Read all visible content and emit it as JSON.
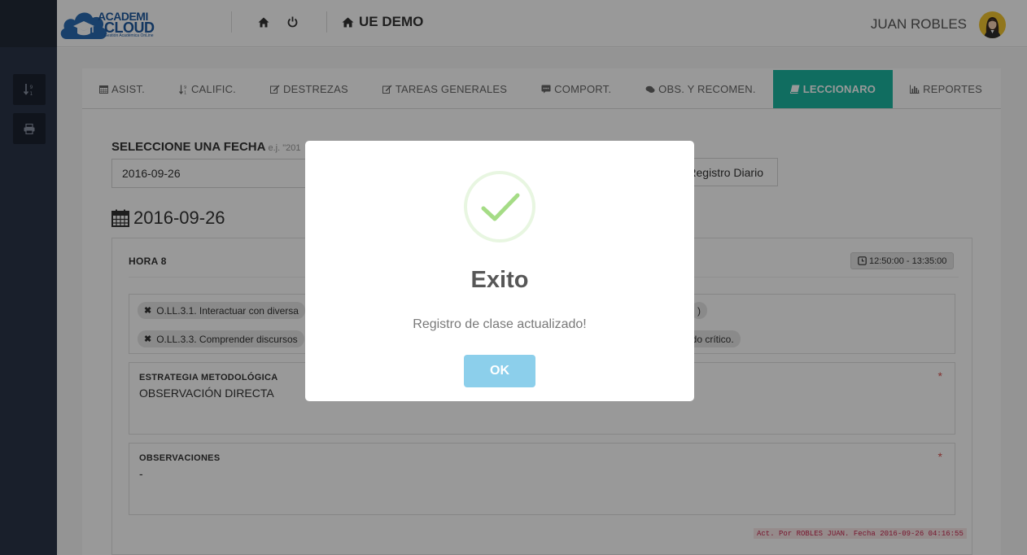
{
  "header": {
    "logo_line1": "ACADEMI",
    "logo_line2": "CLOUD",
    "logo_tagline": "Gestión Académica OnLine",
    "school": "UE DEMO",
    "user": "JUAN ROBLES"
  },
  "sidebar": {
    "items": [
      {
        "icon": "sort-numeric-icon"
      },
      {
        "icon": "print-icon"
      }
    ]
  },
  "tabs": [
    {
      "label": "ASIST.",
      "icon": "calendar-icon"
    },
    {
      "label": "CALIFIC.",
      "icon": "sort-numeric-icon"
    },
    {
      "label": "DESTREZAS",
      "icon": "edit-icon"
    },
    {
      "label": "TAREAS GENERALES",
      "icon": "edit-icon"
    },
    {
      "label": "COMPORT.",
      "icon": "comment-icon"
    },
    {
      "label": "OBS. Y RECOMEN.",
      "icon": "comments-icon"
    },
    {
      "label": "LECCIONARO",
      "icon": "book-icon",
      "active": true
    },
    {
      "label": "REPORTES",
      "icon": "bar-chart-icon"
    }
  ],
  "form": {
    "select_label": "SELECCIONE UNA FECHA",
    "example": "e.j. \"201",
    "date_value": "2016-09-26",
    "register_button": "Registro Diario"
  },
  "lesson": {
    "date_heading": "2016-09-26",
    "hour": "HORA 8",
    "time_range": "12:50:00 - 13:35:00",
    "tags": [
      {
        "label": "O.LL.3.1. Interactuar con diversa",
        "tail": ")"
      },
      {
        "label": "O.LL.3.3. Comprender discursos",
        "tail": "ido crítico."
      }
    ],
    "strategy_label": "ESTRATEGIA METODOLÓGICA",
    "strategy_value": "OBSERVACIÓN DIRECTA",
    "observations_label": "OBSERVACIONES",
    "observations_value": "-",
    "required_mark": "*",
    "audit": "Act. Por ROBLES JUAN. Fecha 2016-09-26 04:16:55"
  },
  "modal": {
    "title": "Exito",
    "message": "Registro de clase actualizado!",
    "ok_label": "OK"
  },
  "colors": {
    "accent": "#1cb6a0",
    "sidebar": "#2a3548",
    "ok_button": "#8ccfeb",
    "success": "#a5dc86"
  }
}
